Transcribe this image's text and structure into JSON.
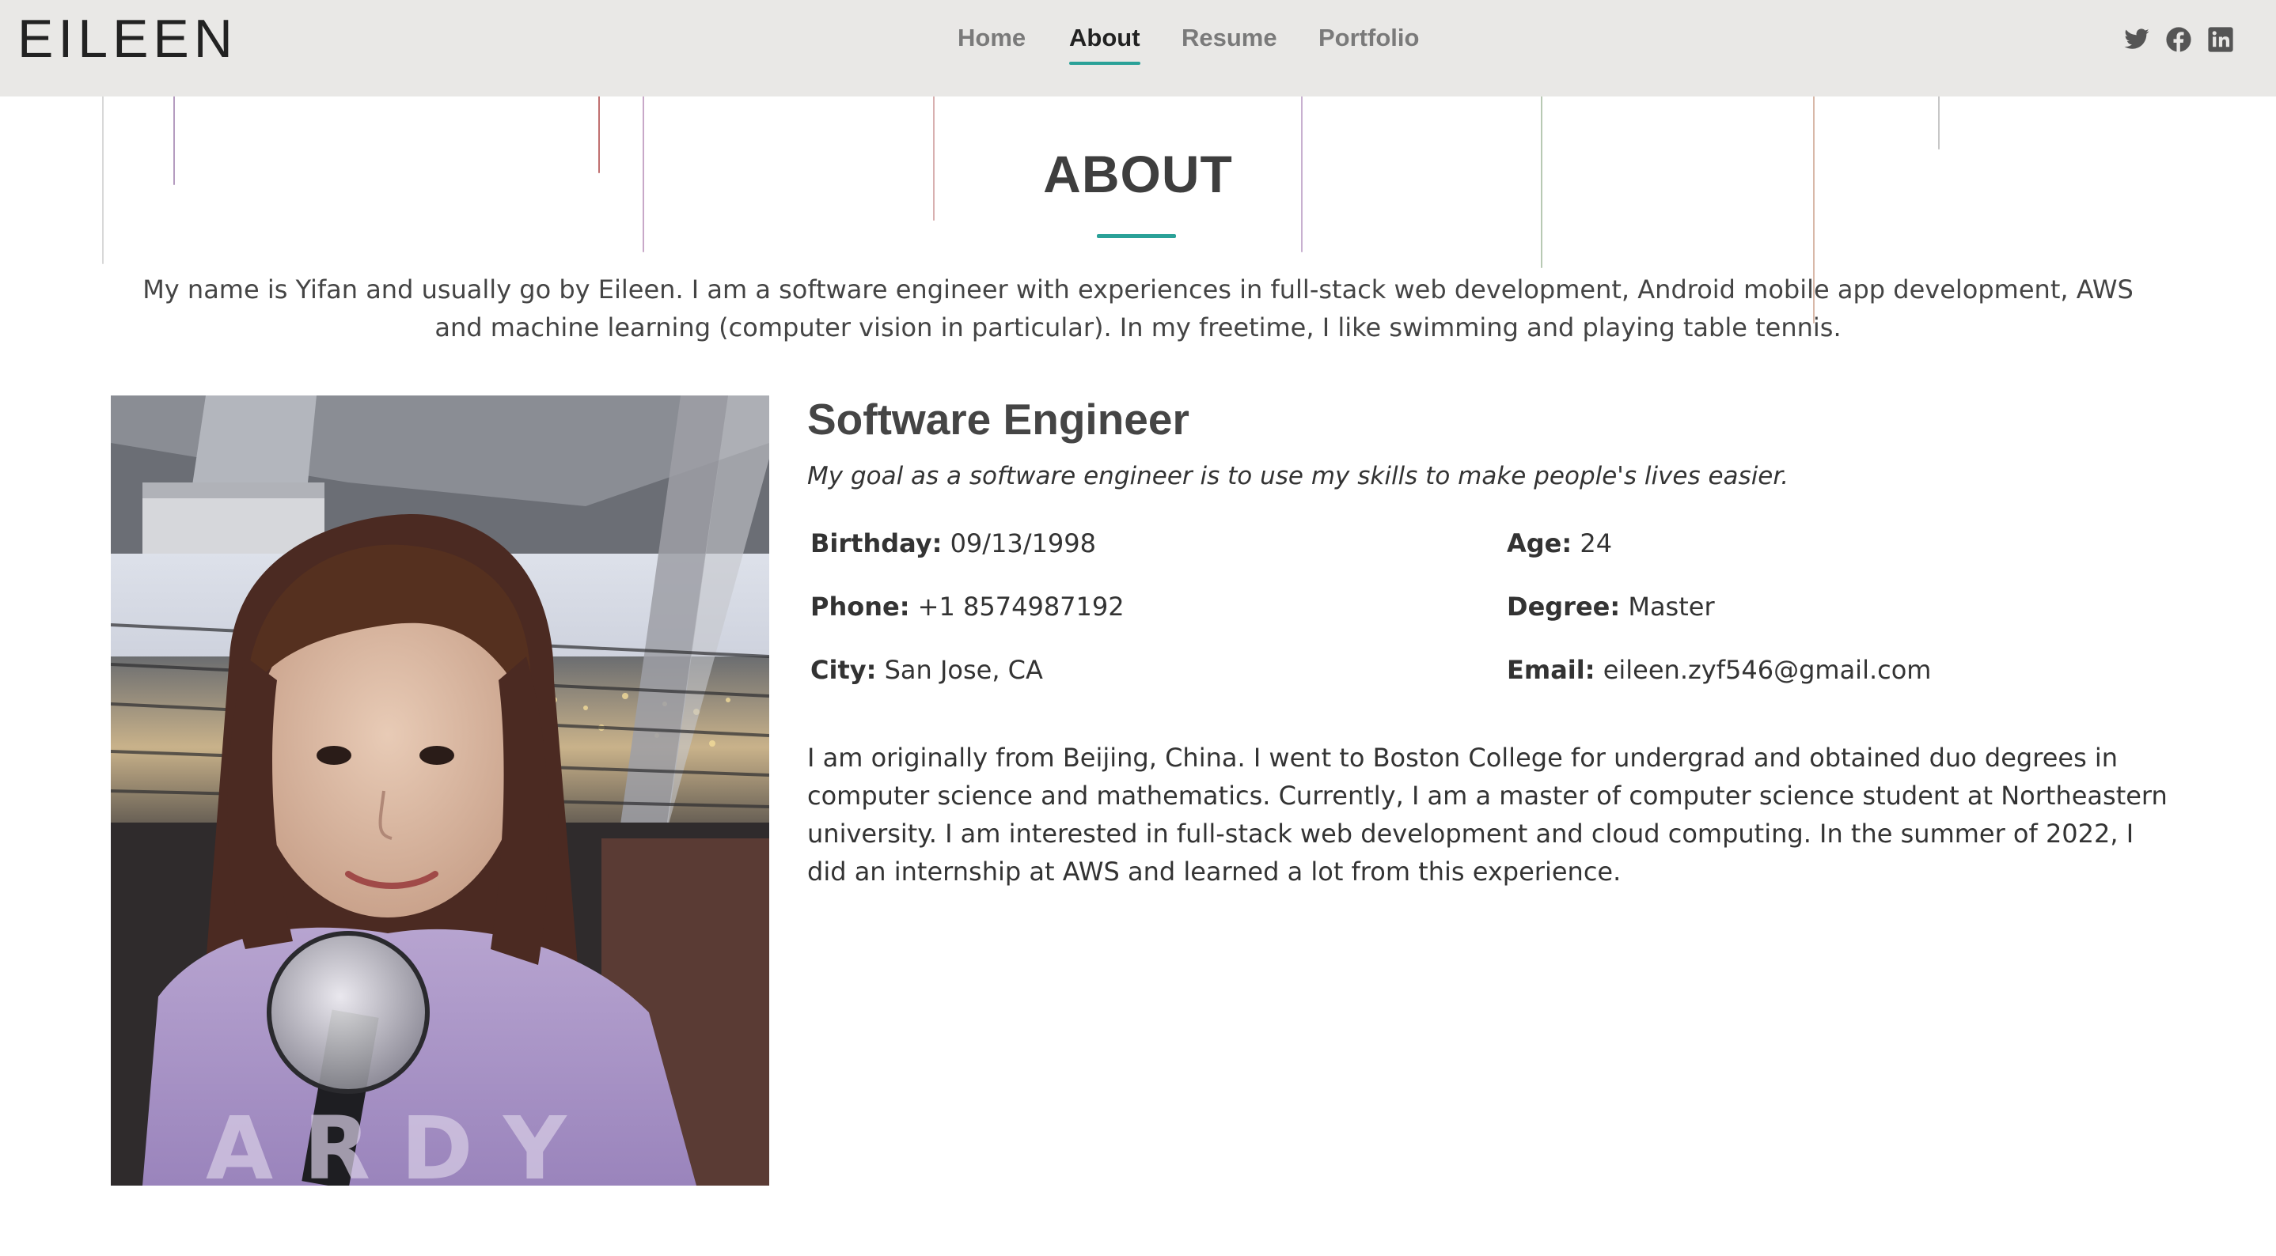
{
  "header": {
    "logo": "EILEEN",
    "nav": [
      {
        "label": "Home",
        "active": false
      },
      {
        "label": "About",
        "active": true
      },
      {
        "label": "Resume",
        "active": false
      },
      {
        "label": "Portfolio",
        "active": false
      }
    ],
    "social": [
      "twitter-icon",
      "facebook-icon",
      "linkedin-icon"
    ]
  },
  "about": {
    "title": "ABOUT",
    "intro": "My name is Yifan and usually go by Eileen. I am a software engineer with experiences in full-stack web development, Android mobile app development, AWS and machine learning (computer vision in particular). In my freetime, I like swimming and playing table tennis.",
    "role": "Software Engineer",
    "tagline": "My goal as a software engineer is to use my skills to make people's lives easier.",
    "facts": {
      "birthday": {
        "label": "Birthday:",
        "value": "09/13/1998"
      },
      "age": {
        "label": "Age:",
        "value": "24"
      },
      "phone": {
        "label": "Phone:",
        "value": "+1 8574987192"
      },
      "degree": {
        "label": "Degree:",
        "value": "Master"
      },
      "city": {
        "label": "City:",
        "value": "San Jose, CA"
      },
      "email": {
        "label": "Email:",
        "value": "eileen.zyf546@gmail.com"
      }
    },
    "bio": "I am originally from Beijing, China. I went to Boston College for undergrad and obtained duo degrees in computer science and mathematics. Currently, I am a master of computer science student at Northeastern university. I am interested in full-stack web development and cloud computing. In the summer of 2022, I did an internship at AWS and learned a lot from this experience."
  },
  "colors": {
    "accent": "#2aa198",
    "header_bg": "#e9e8e6",
    "rain_green": "#5e8a5a",
    "rain_red": "#b45a58",
    "rain_purple": "#9a6aa8"
  }
}
